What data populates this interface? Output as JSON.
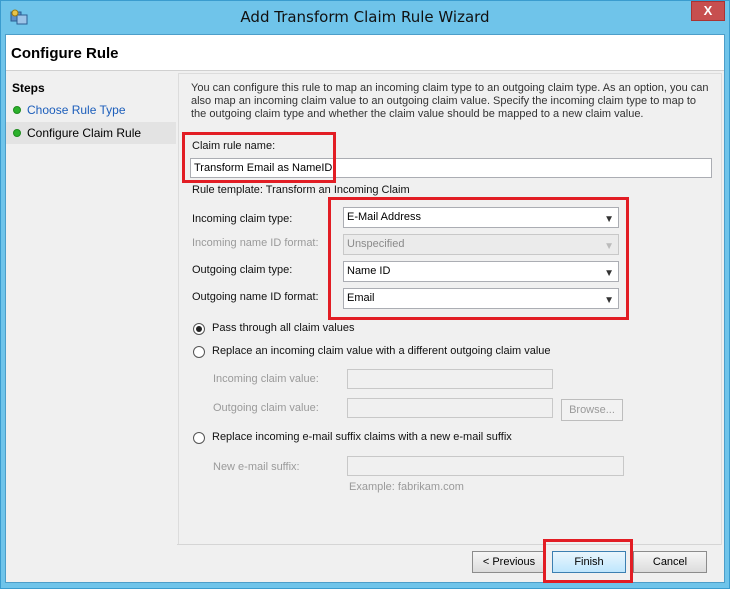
{
  "window": {
    "title": "Add Transform Claim Rule Wizard",
    "close_glyph": "X"
  },
  "header": {
    "page_title": "Configure Rule"
  },
  "steps": {
    "title": "Steps",
    "items": [
      {
        "label": "Choose Rule Type",
        "state": "link"
      },
      {
        "label": "Configure Claim Rule",
        "state": "current"
      }
    ]
  },
  "main": {
    "description": "You can configure this rule to map an incoming claim type to an outgoing claim type. As an option, you can also map an incoming claim value to an outgoing claim value. Specify the incoming claim type to map to the outgoing claim type and whether the claim value should be mapped to a new claim value.",
    "claim_rule_name_label": "Claim rule name:",
    "claim_rule_name_value": "Transform Email as NameID",
    "rule_template": "Rule template: Transform an Incoming Claim",
    "incoming_claim_type_label": "Incoming claim type:",
    "incoming_claim_type_value": "E-Mail Address",
    "incoming_name_id_format_label": "Incoming name ID format:",
    "incoming_name_id_format_value": "Unspecified",
    "outgoing_claim_type_label": "Outgoing claim type:",
    "outgoing_claim_type_value": "Name ID",
    "outgoing_name_id_format_label": "Outgoing name ID format:",
    "outgoing_name_id_format_value": "Email",
    "options": {
      "pass_through": "Pass through all claim values",
      "replace_value": "Replace an incoming claim value with a different outgoing claim value",
      "replace_suffix": "Replace incoming e-mail suffix claims with a new e-mail suffix",
      "selected": "pass_through"
    },
    "incoming_claim_value_label": "Incoming claim value:",
    "outgoing_claim_value_label": "Outgoing claim value:",
    "browse_label": "Browse...",
    "new_email_suffix_label": "New e-mail suffix:",
    "example_text": "Example: fabrikam.com"
  },
  "footer": {
    "previous_label": "< Previous",
    "finish_label": "Finish",
    "cancel_label": "Cancel"
  },
  "colors": {
    "highlight": "#e21d24",
    "titlebar": "#6fc4ea",
    "step_dot": "#2cb12c",
    "link": "#1c5ebb"
  }
}
